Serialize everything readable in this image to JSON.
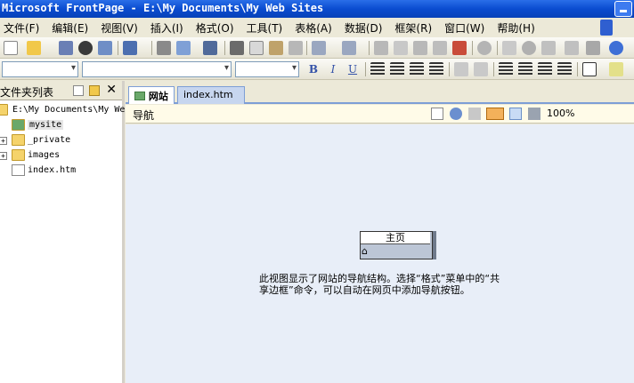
{
  "window": {
    "title": "Microsoft FrontPage - E:\\My Documents\\My Web Sites"
  },
  "menu": {
    "items": [
      "文件(F)",
      "编辑(E)",
      "视图(V)",
      "插入(I)",
      "格式(O)",
      "工具(T)",
      "表格(A)",
      "数据(D)",
      "框架(R)",
      "窗口(W)",
      "帮助(H)"
    ]
  },
  "toolbar_icons": [
    "new-page",
    "open",
    "save",
    "search",
    "publish",
    "toggle-pane",
    "print",
    "preview",
    "spelling",
    "cut",
    "copy",
    "paste",
    "format-painter",
    "undo",
    "redo",
    "web-component",
    "insert-table",
    "insert-layer",
    "insert-picture",
    "drawing",
    "hyperlink",
    "refresh",
    "stop",
    "show-all",
    "help"
  ],
  "format_icons": [
    "bold",
    "italic",
    "underline",
    "align-left",
    "align-center",
    "align-right",
    "justify",
    "increase-font",
    "decrease-font",
    "numbering",
    "bullets",
    "decrease-indent",
    "increase-indent",
    "borders",
    "highlight"
  ],
  "format_labels": {
    "bold": "B",
    "italic": "I",
    "underline": "U"
  },
  "folder_list": {
    "title": "文件夹列表",
    "root": "E:\\My Documents\\My Web",
    "items": [
      {
        "label": "mysite",
        "icon": "web-folder-icon",
        "expandable": false,
        "selected": true
      },
      {
        "label": "_private",
        "icon": "folder-icon",
        "expandable": true
      },
      {
        "label": "images",
        "icon": "folder-icon",
        "expandable": true
      },
      {
        "label": "index.htm",
        "icon": "html-file-icon",
        "expandable": false
      }
    ]
  },
  "tabs": [
    {
      "label": "网站",
      "active": true
    },
    {
      "label": "index.htm",
      "active": false
    }
  ],
  "view": {
    "name": "导航",
    "zoom": "100%",
    "home_node": "主页",
    "hint_line1": "此视图显示了网站的导航结构。选择“格式”菜单中的“共",
    "hint_line2": "享边框”命令，可以自动在网页中添加导航按钮。"
  },
  "colors": {
    "title_bar": "#0a4cd0",
    "canvas": "#e8eef8",
    "tab_border": "#7d9ed6"
  }
}
